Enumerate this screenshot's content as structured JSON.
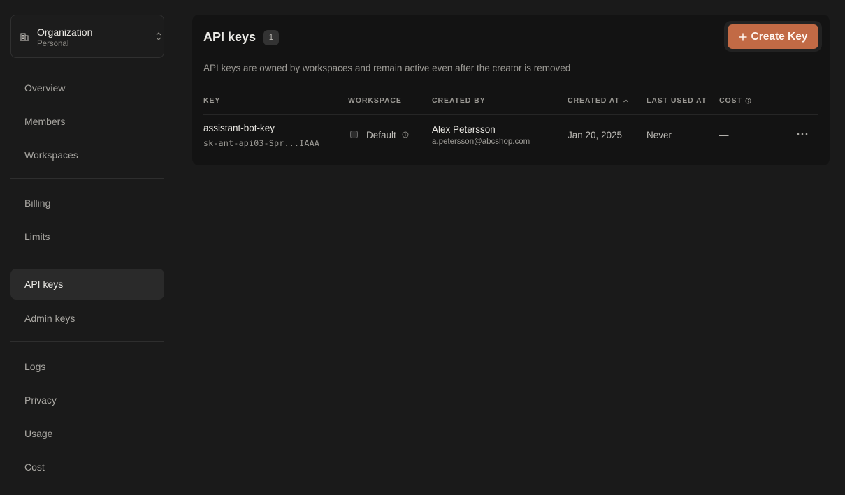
{
  "organization": {
    "name": "Organization",
    "subtitle": "Personal",
    "icon": "building-icon",
    "switcher_icon": "chevron-up-down-icon"
  },
  "sidebar": {
    "items": [
      {
        "label": "Overview"
      },
      {
        "label": "Members"
      },
      {
        "label": "Workspaces"
      },
      {
        "label": "Billing"
      },
      {
        "label": "Limits"
      },
      {
        "label": "API keys",
        "active": true
      },
      {
        "label": "Admin keys"
      },
      {
        "label": "Logs"
      },
      {
        "label": "Privacy"
      },
      {
        "label": "Usage"
      },
      {
        "label": "Cost"
      }
    ]
  },
  "main": {
    "title": "API keys",
    "count": "1",
    "create_button": "Create Key",
    "description": "API keys are owned by workspaces and remain active even after the creator is removed",
    "columns": {
      "key": "KEY",
      "workspace": "WORKSPACE",
      "created_by": "CREATED BY",
      "created_at": "CREATED AT",
      "last_used_at": "LAST USED AT",
      "cost": "COST"
    },
    "rows": [
      {
        "name": "assistant-bot-key",
        "key_masked": "sk-ant-api03-Spr...IAAA",
        "workspace": "Default",
        "creator_name": "Alex Petersson",
        "creator_email": "a.petersson@abcshop.com",
        "created_at": "Jan 20, 2025",
        "last_used": "Never",
        "cost": "—"
      }
    ]
  },
  "colors": {
    "background": "#1a1a1a",
    "card": "#131313",
    "accent": "#c26a45",
    "active_nav": "#2a2a2a"
  }
}
